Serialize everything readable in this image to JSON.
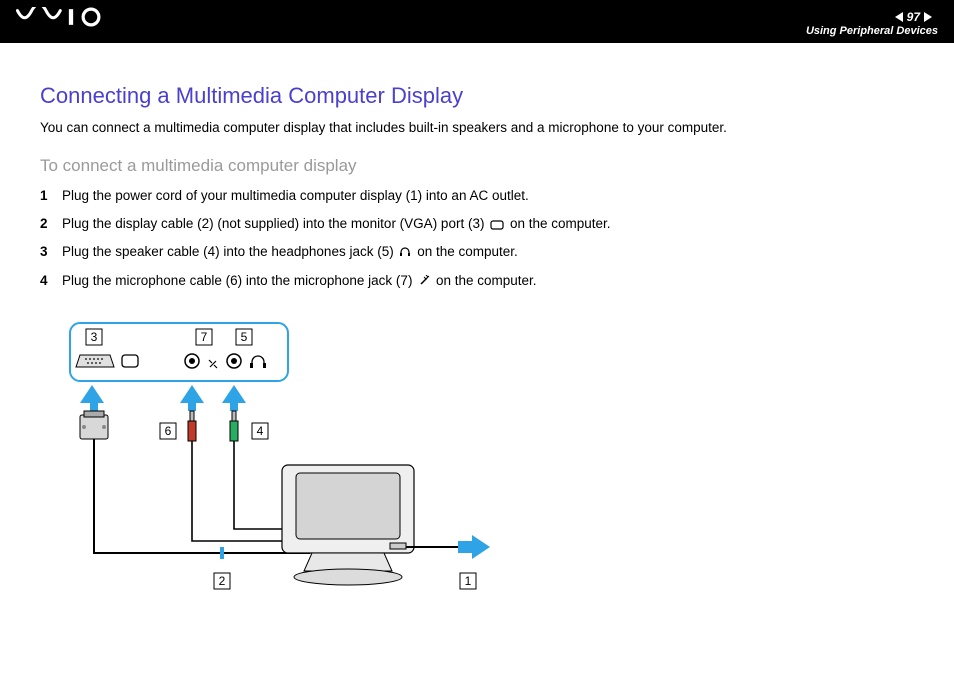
{
  "header": {
    "page_number": "97",
    "breadcrumb": "Using Peripheral Devices"
  },
  "content": {
    "title": "Connecting a Multimedia Computer Display",
    "intro": "You can connect a multimedia computer display that includes built-in speakers and a microphone to your computer.",
    "subtitle": "To connect a multimedia computer display",
    "steps": [
      {
        "n": "1",
        "text_before": "Plug the power cord of your multimedia computer display (1) into an AC outlet.",
        "icon": null,
        "text_after": ""
      },
      {
        "n": "2",
        "text_before": "Plug the display cable (2) (not supplied) into the monitor (VGA) port (3) ",
        "icon": "monitor-port-icon",
        "text_after": " on the computer."
      },
      {
        "n": "3",
        "text_before": "Plug the speaker cable (4) into the headphones jack (5) ",
        "icon": "headphones-icon",
        "text_after": " on the computer."
      },
      {
        "n": "4",
        "text_before": "Plug the microphone cable (6) into the microphone jack (7) ",
        "icon": "microphone-plug-icon",
        "text_after": " on the computer."
      }
    ]
  },
  "diagram": {
    "labels": {
      "port_labels": [
        "3",
        "7",
        "5"
      ],
      "cable_labels": [
        "6",
        "4",
        "2",
        "1"
      ]
    }
  }
}
